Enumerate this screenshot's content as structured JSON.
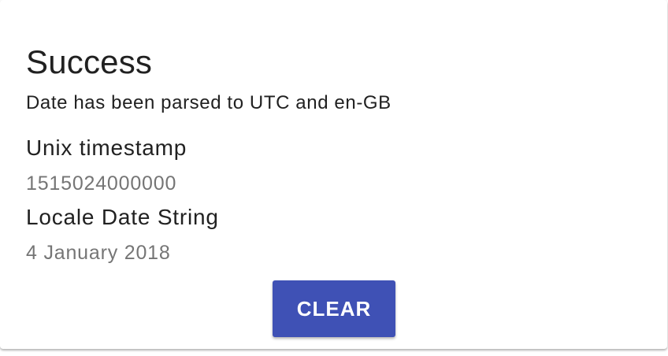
{
  "result": {
    "title": "Success",
    "message": "Date has been parsed to UTC and en-GB"
  },
  "fields": {
    "unix_label": "Unix timestamp",
    "unix_value": "1515024000000",
    "locale_label": "Locale Date String",
    "locale_value": "4 January 2018"
  },
  "actions": {
    "clear_label": "CLEAR"
  },
  "colors": {
    "primary": "#3f51b5",
    "text": "#212121",
    "secondary_text": "#757575"
  }
}
